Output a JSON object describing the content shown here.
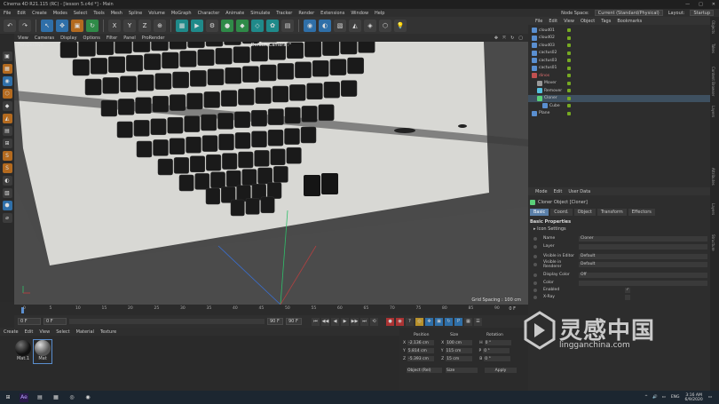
{
  "titlebar": {
    "text": "Cinema 4D R21.115 (RC) - [lesson 5.c4d *] - Main",
    "min": "—",
    "max": "□",
    "close": "✕"
  },
  "menubar": {
    "items": [
      "File",
      "Edit",
      "Create",
      "Modes",
      "Select",
      "Tools",
      "Mesh",
      "Spline",
      "Volume",
      "MoGraph",
      "Character",
      "Animate",
      "Simulate",
      "Tracker",
      "Render",
      "Extensions",
      "Window",
      "Help"
    ],
    "node_space_label": "Node Space:",
    "node_space_value": "Current (Standard/Physical)",
    "layout_label": "Layout:",
    "layout_value": "Startup"
  },
  "toolbar": {
    "icons": [
      "↶",
      "↷",
      "↖",
      "✥",
      "▣",
      "↻",
      "X",
      "Y",
      "Z",
      "⊕",
      "▦",
      "▶",
      "⚙",
      "●",
      "◆",
      "◇",
      "✿",
      "▤",
      "◉",
      "◐",
      "▧",
      "◭",
      "◈",
      "⬡",
      "💡"
    ]
  },
  "lefttools": {
    "icons": [
      "▣",
      "▦",
      "◉",
      "⬡",
      "◆",
      "◭",
      "▤",
      "⊞",
      "S",
      "S",
      "◐",
      "▧",
      "⬢",
      "⌀"
    ]
  },
  "vpmenu": {
    "items": [
      "View",
      "Cameras",
      "Display",
      "Options",
      "Filter",
      "Panel",
      "ProRender"
    ],
    "icons": [
      "✥",
      "⤧",
      "↻",
      "▢"
    ]
  },
  "viewport": {
    "title": "Default Camera ⁝°",
    "perspective": "Perspective",
    "grid_spacing": "Grid Spacing : 100 cm"
  },
  "timeline": {
    "ticks": [
      "0",
      "5",
      "10",
      "15",
      "20",
      "25",
      "30",
      "35",
      "40",
      "45",
      "50",
      "55",
      "60",
      "65",
      "70",
      "75",
      "80",
      "85",
      "90"
    ],
    "end": "0 F"
  },
  "transport": {
    "start": "0 F",
    "current": "0 F",
    "end": "90 F",
    "end2": "90 F",
    "buttons": [
      "⏮",
      "◀◀",
      "◀",
      "▶",
      "▶▶",
      "⏭",
      "⟲"
    ]
  },
  "matmenu": {
    "items": [
      "Create",
      "Edit",
      "View",
      "Select",
      "Material",
      "Texture"
    ]
  },
  "materials": [
    {
      "label": "Mat.1"
    },
    {
      "label": "Mat"
    }
  ],
  "coords": {
    "headers": [
      "Position",
      "Size",
      "Rotation"
    ],
    "rows": [
      {
        "axis": "X",
        "pos": "-2.136 cm",
        "size": "100 cm",
        "rot_axis": "H",
        "rot": "0 °"
      },
      {
        "axis": "Y",
        "pos": "5.814 cm",
        "size": "115 cm",
        "rot_axis": "P",
        "rot": "0 °"
      },
      {
        "axis": "Z",
        "pos": "-5.393 cm",
        "size": "15 cm",
        "rot_axis": "B",
        "rot": "0 °"
      }
    ],
    "mode1": "Object (Rel)",
    "mode2": "Size",
    "apply": "Apply"
  },
  "objpanel": {
    "menu": [
      "File",
      "Edit",
      "View",
      "Object",
      "Tags",
      "Bookmarks"
    ],
    "objects": [
      {
        "name": "cloud01",
        "indent": 0,
        "color": "#5a8fd0"
      },
      {
        "name": "cloud02",
        "indent": 0,
        "color": "#5a8fd0"
      },
      {
        "name": "cloud03",
        "indent": 0,
        "color": "#5a8fd0"
      },
      {
        "name": "cactus02",
        "indent": 0,
        "color": "#5a8fd0"
      },
      {
        "name": "cactus03",
        "indent": 0,
        "color": "#5a8fd0"
      },
      {
        "name": "cactus01",
        "indent": 0,
        "color": "#5a8fd0"
      },
      {
        "name": "dinos",
        "indent": 0,
        "color": "#c05050"
      },
      {
        "name": "Mover",
        "indent": 1,
        "color": "#9a9a9a"
      },
      {
        "name": "Remover",
        "indent": 1,
        "color": "#55c0e0"
      },
      {
        "name": "Cloner",
        "indent": 1,
        "color": "#5ad07a"
      },
      {
        "name": "Cube",
        "indent": 2,
        "color": "#5a8fd0"
      },
      {
        "name": "Plane",
        "indent": 0,
        "color": "#5a8fd0"
      }
    ]
  },
  "attrpanel": {
    "menu": [
      "Mode",
      "Edit",
      "User Data"
    ],
    "object_title": "Cloner Object [Cloner]",
    "tabs": [
      "Basic",
      "Coord.",
      "Object",
      "Transform",
      "Effectors"
    ],
    "section": "Basic Properties",
    "subsection": "▸ Icon Settings",
    "fields": [
      {
        "label": "Name",
        "value": "Cloner"
      },
      {
        "label": "Layer",
        "value": ""
      },
      {
        "label": "Visible in Editor",
        "value": "Default"
      },
      {
        "label": "Visible in Renderer",
        "value": "Default"
      },
      {
        "label": "Display Color",
        "value": "Off"
      },
      {
        "label": "Color",
        "value": ""
      },
      {
        "label": "Enabled",
        "value": "✓"
      },
      {
        "label": "X-Ray",
        "value": ""
      }
    ]
  },
  "rightstrip": {
    "labels": [
      "Objects",
      "Takes",
      "Content Browser",
      "Layers",
      "Attributes",
      "Layers",
      "Structure"
    ]
  },
  "taskbar": {
    "icons": [
      "⊞",
      "Ae",
      "▤",
      "▦",
      "◎",
      "◉"
    ],
    "time": "3:16 AM",
    "date": "6/9/2020",
    "lang": "ENG",
    "tray": [
      "^",
      "🔊",
      "▭"
    ]
  },
  "watermark": {
    "cn": "灵感中国",
    "url": "lingganchina.com"
  },
  "colors": {
    "accent": "#2f6fa8",
    "viewport_bg": "#4b4b4b",
    "plane": "#d8d8d4"
  }
}
